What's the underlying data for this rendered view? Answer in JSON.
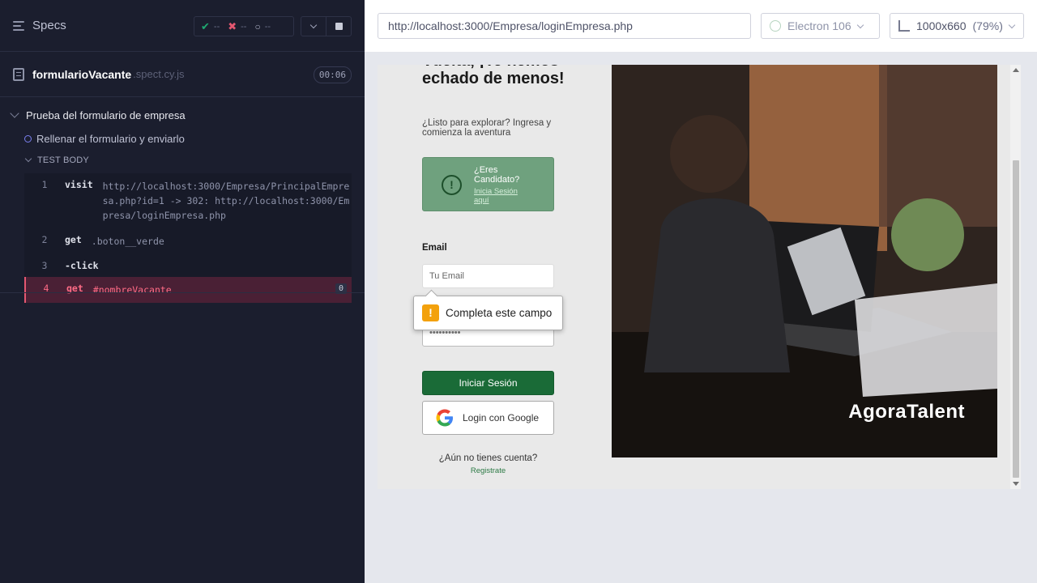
{
  "reporter": {
    "title": "Specs",
    "stats": {
      "passed": "--",
      "failed": "--",
      "pending": "--"
    },
    "spec": {
      "name": "formularioVacante",
      "ext": ".spect.cy.js",
      "duration": "00:06"
    },
    "suite_title": "Prueba del formulario de empresa",
    "test_title": "Rellenar el formulario y enviarlo",
    "test_body_label": "TEST BODY",
    "commands": [
      {
        "num": "1",
        "name": "visit",
        "message": "http://localhost:3000/Empresa/PrincipalEmpresa.php?id=1 -> 302: http://localhost:3000/Empresa/loginEmpresa.php"
      },
      {
        "num": "2",
        "name": "get",
        "message": ".boton__verde"
      },
      {
        "num": "3",
        "name": "-click",
        "message": ""
      },
      {
        "num": "4",
        "name": "get",
        "message": "#nombreVacante",
        "badge": "0"
      }
    ]
  },
  "header": {
    "url": "http://localhost:3000/Empresa/loginEmpresa.php",
    "browser": "Electron 106",
    "viewport": "1000x660",
    "zoom": "(79%)"
  },
  "aut": {
    "greeting": "Vuelta, ¡Te hemos echado de menos!",
    "subtitle": "¿Listo para explorar? Ingresa y comienza la aventura",
    "candidate_title": "¿Eres Candidato?",
    "candidate_link": "Inicia Sesión aquí",
    "email_label": "Email",
    "email_placeholder": "Tu Email",
    "password_value": "••••••••••",
    "tooltip_text": "Completa este campo",
    "login_button": "Iniciar Sesión",
    "google_button": "Login con Google",
    "no_account_text": "¿Aún no tienes cuenta?",
    "register_link": "Registrate",
    "brand": "AgoraTalent"
  },
  "colors": {
    "reporter_bg": "#1b1e2e",
    "active_command": "#4a2035",
    "accent_red": "#e45770",
    "accent_green": "#1fa971",
    "login_button": "#1a6b37",
    "candidate_box": "#6fa17e"
  }
}
